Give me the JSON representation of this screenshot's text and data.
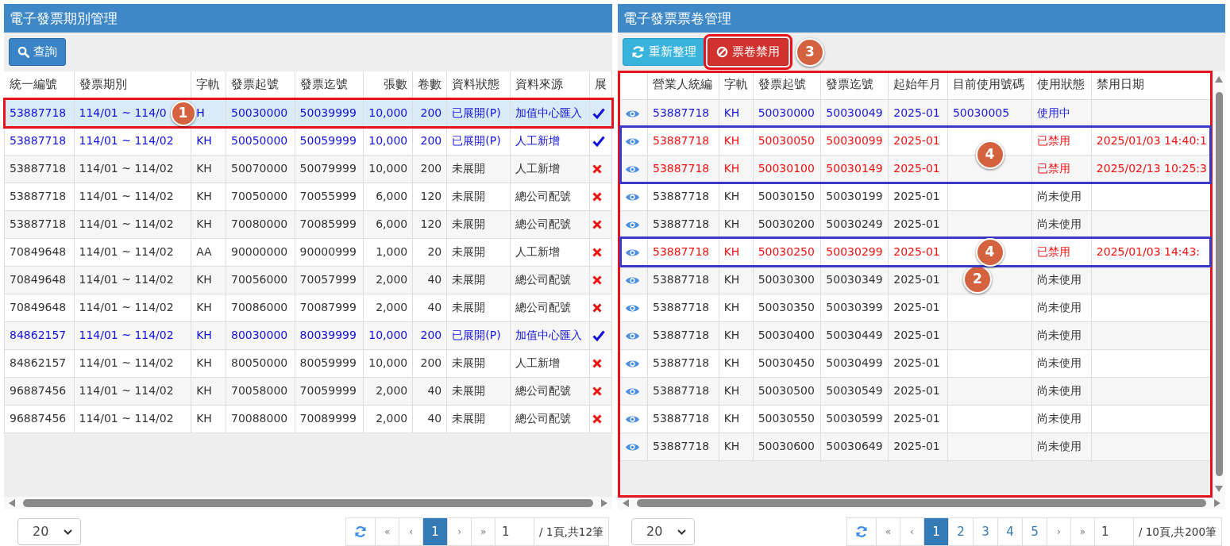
{
  "left_panel": {
    "title": "電子發票期別管理",
    "toolbar": [
      {
        "label": "查詢",
        "kind": "search",
        "marked": false
      }
    ],
    "table": {
      "columns": [
        "統一編號",
        "發票期別",
        "字軌",
        "發票起號",
        "發票迄號",
        "張數",
        "卷數",
        "資料狀態",
        "資料來源",
        "展"
      ],
      "rows": [
        {
          "cells": [
            "53887718",
            "114/01 ~ 114/0",
            "H",
            "50030000",
            "50039999",
            "10,000",
            "200",
            "已展開(P)",
            "加值中心匯入"
          ],
          "expanded": true,
          "selected": true,
          "marked": true,
          "callout": "1"
        },
        {
          "cells": [
            "53887718",
            "114/01 ~ 114/02",
            "KH",
            "50050000",
            "50059999",
            "10,000",
            "200",
            "已展開(P)",
            "人工新增"
          ],
          "expanded": true,
          "selected": false,
          "marked": false
        },
        {
          "cells": [
            "53887718",
            "114/01 ~ 114/02",
            "KH",
            "50070000",
            "50079999",
            "10,000",
            "200",
            "未展開",
            "人工新增"
          ],
          "expanded": false,
          "selected": false,
          "marked": false
        },
        {
          "cells": [
            "53887718",
            "114/01 ~ 114/02",
            "KH",
            "70050000",
            "70055999",
            "6,000",
            "120",
            "未展開",
            "總公司配號"
          ],
          "expanded": false,
          "selected": false,
          "marked": false
        },
        {
          "cells": [
            "53887718",
            "114/01 ~ 114/02",
            "KH",
            "70080000",
            "70085999",
            "6,000",
            "120",
            "未展開",
            "總公司配號"
          ],
          "expanded": false,
          "selected": false,
          "marked": false
        },
        {
          "cells": [
            "70849648",
            "114/01 ~ 114/02",
            "AA",
            "90000000",
            "90000999",
            "1,000",
            "20",
            "未展開",
            "人工新增"
          ],
          "expanded": false,
          "selected": false,
          "marked": false
        },
        {
          "cells": [
            "70849648",
            "114/01 ~ 114/02",
            "KH",
            "70056000",
            "70057999",
            "2,000",
            "40",
            "未展開",
            "總公司配號"
          ],
          "expanded": false,
          "selected": false,
          "marked": false
        },
        {
          "cells": [
            "70849648",
            "114/01 ~ 114/02",
            "KH",
            "70086000",
            "70087999",
            "2,000",
            "40",
            "未展開",
            "總公司配號"
          ],
          "expanded": false,
          "selected": false,
          "marked": false
        },
        {
          "cells": [
            "84862157",
            "114/01 ~ 114/02",
            "KH",
            "80030000",
            "80039999",
            "10,000",
            "200",
            "已展開(P)",
            "加值中心匯入"
          ],
          "expanded": true,
          "selected": false,
          "marked": false
        },
        {
          "cells": [
            "84862157",
            "114/01 ~ 114/02",
            "KH",
            "80050000",
            "80059999",
            "10,000",
            "200",
            "未展開",
            "人工新增"
          ],
          "expanded": false,
          "selected": false,
          "marked": false
        },
        {
          "cells": [
            "96887456",
            "114/01 ~ 114/02",
            "KH",
            "70058000",
            "70059999",
            "2,000",
            "40",
            "未展開",
            "總公司配號"
          ],
          "expanded": false,
          "selected": false,
          "marked": false
        },
        {
          "cells": [
            "96887456",
            "114/01 ~ 114/02",
            "KH",
            "70088000",
            "70089999",
            "2,000",
            "40",
            "未展開",
            "總公司配號"
          ],
          "expanded": false,
          "selected": false,
          "marked": false
        }
      ]
    },
    "pager": {
      "page_size": "20",
      "first": "«",
      "prev": "‹",
      "pages": [
        {
          "label": "1",
          "selected": true
        }
      ],
      "next": "›",
      "last": "»",
      "page_input": "1",
      "summary": "/ 1頁,共12筆"
    }
  },
  "right_panel": {
    "title": "電子發票票卷管理",
    "toolbar": [
      {
        "label": "重新整理",
        "kind": "refresh",
        "marked": false
      },
      {
        "label": "票卷禁用",
        "kind": "disable",
        "marked": true,
        "callout": "3"
      }
    ],
    "table": {
      "columns": [
        "營業人統編",
        "字軌",
        "發票起號",
        "發票迄號",
        "起始年月",
        "目前使用號碼",
        "使用狀態",
        "禁用日期"
      ],
      "marked": true,
      "callout": "2",
      "rows": [
        {
          "cells": [
            "53887718",
            "KH",
            "50030000",
            "50030049",
            "2025-01",
            "50030005",
            "使用中",
            ""
          ],
          "kind": "in_use",
          "marked": false
        },
        {
          "cells": [
            "53887718",
            "KH",
            "50030050",
            "50030099",
            "2025-01",
            "",
            "已禁用",
            "2025/01/03 14:40:1"
          ],
          "kind": "disabled",
          "marked": true,
          "callout": "4"
        },
        {
          "cells": [
            "53887718",
            "KH",
            "50030100",
            "50030149",
            "2025-01",
            "",
            "已禁用",
            "2025/02/13 10:25:3"
          ],
          "kind": "disabled",
          "marked": true
        },
        {
          "cells": [
            "53887718",
            "KH",
            "50030150",
            "50030199",
            "2025-01",
            "",
            "尚未使用",
            ""
          ],
          "kind": "unused",
          "marked": false
        },
        {
          "cells": [
            "53887718",
            "KH",
            "50030200",
            "50030249",
            "2025-01",
            "",
            "尚未使用",
            ""
          ],
          "kind": "unused",
          "marked": false
        },
        {
          "cells": [
            "53887718",
            "KH",
            "50030250",
            "50030299",
            "2025-01",
            "",
            "已禁用",
            "2025/01/03 14:43:"
          ],
          "kind": "disabled",
          "marked": true,
          "callout": "4"
        },
        {
          "cells": [
            "53887718",
            "KH",
            "50030300",
            "50030349",
            "2025-01",
            "",
            "尚未使用",
            ""
          ],
          "kind": "unused",
          "marked": false
        },
        {
          "cells": [
            "53887718",
            "KH",
            "50030350",
            "50030399",
            "2025-01",
            "",
            "尚未使用",
            ""
          ],
          "kind": "unused",
          "marked": false
        },
        {
          "cells": [
            "53887718",
            "KH",
            "50030400",
            "50030449",
            "2025-01",
            "",
            "尚未使用",
            ""
          ],
          "kind": "unused",
          "marked": false
        },
        {
          "cells": [
            "53887718",
            "KH",
            "50030450",
            "50030499",
            "2025-01",
            "",
            "尚未使用",
            ""
          ],
          "kind": "unused",
          "marked": false
        },
        {
          "cells": [
            "53887718",
            "KH",
            "50030500",
            "50030549",
            "2025-01",
            "",
            "尚未使用",
            ""
          ],
          "kind": "unused",
          "marked": false
        },
        {
          "cells": [
            "53887718",
            "KH",
            "50030550",
            "50030599",
            "2025-01",
            "",
            "尚未使用",
            ""
          ],
          "kind": "unused",
          "marked": false
        },
        {
          "cells": [
            "53887718",
            "KH",
            "50030600",
            "50030649",
            "2025-01",
            "",
            "尚未使用",
            ""
          ],
          "kind": "unused",
          "marked": false
        }
      ]
    },
    "pager": {
      "page_size": "20",
      "first": "«",
      "prev": "‹",
      "pages": [
        {
          "label": "1",
          "selected": true
        },
        {
          "label": "2",
          "selected": false
        },
        {
          "label": "3",
          "selected": false
        },
        {
          "label": "4",
          "selected": false
        },
        {
          "label": "5",
          "selected": false
        }
      ],
      "next": "›",
      "last": "»",
      "page_input": "1",
      "summary": "/ 10頁,共200筆"
    }
  }
}
